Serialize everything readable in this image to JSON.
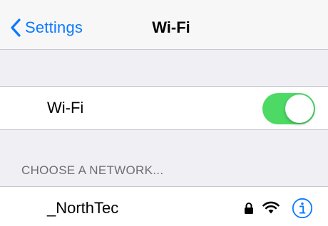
{
  "navbar": {
    "back_label": "Settings",
    "title": "Wi-Fi"
  },
  "wifi_row": {
    "label": "Wi-Fi",
    "toggle_on": true
  },
  "networks_section": {
    "header": "CHOOSE A NETWORK...",
    "networks": [
      {
        "name": "_NorthTec",
        "secured": true,
        "icons": [
          "lock-icon",
          "wifi-signal-icon",
          "info-icon"
        ]
      }
    ]
  },
  "colors": {
    "accent": "#0a7aff",
    "toggle_on": "#4cd964",
    "background": "#efeff4",
    "section_header_text": "#6d6d72"
  }
}
